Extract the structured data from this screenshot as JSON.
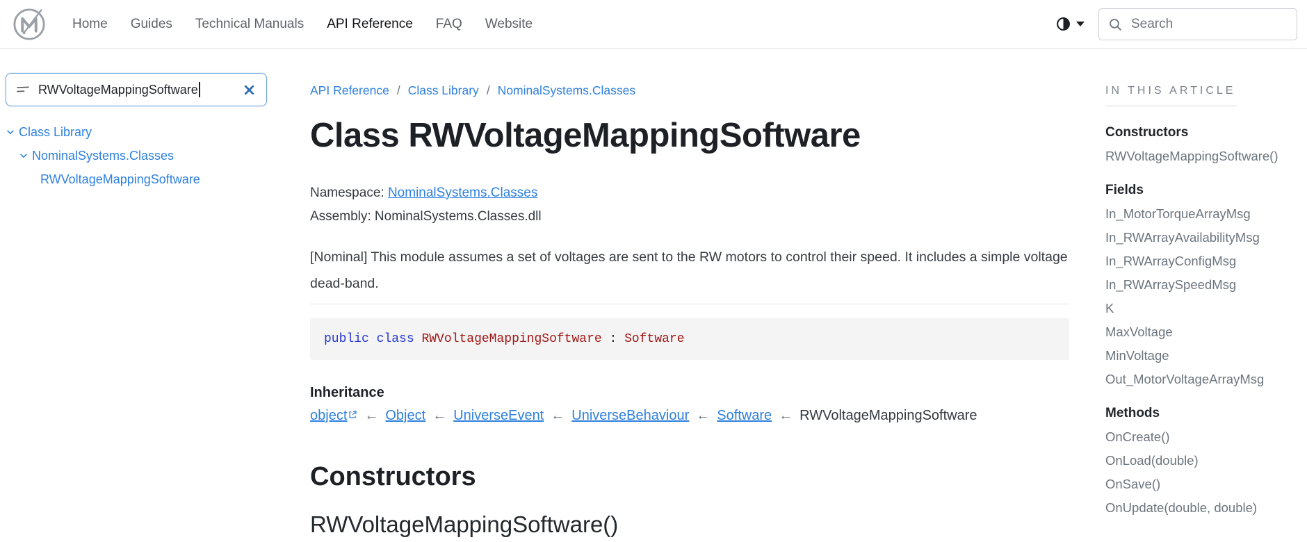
{
  "navbar": {
    "links": [
      {
        "label": "Home",
        "active": false
      },
      {
        "label": "Guides",
        "active": false
      },
      {
        "label": "Technical Manuals",
        "active": false
      },
      {
        "label": "API Reference",
        "active": true
      },
      {
        "label": "FAQ",
        "active": false
      },
      {
        "label": "Website",
        "active": false
      }
    ],
    "search": {
      "placeholder": "Search"
    },
    "theme_icon": "half-circle-icon",
    "logo_icon": "m-check-logo"
  },
  "sidebar": {
    "filter": {
      "value": "RWVoltageMappingSoftware",
      "icon": "filter-lines-icon",
      "clear_icon": "x-icon"
    },
    "tree": [
      {
        "label": "Class Library",
        "level": 0,
        "expanded": true
      },
      {
        "label": "NominalSystems.Classes",
        "level": 1,
        "expanded": true
      },
      {
        "label": "RWVoltageMappingSoftware",
        "level": 2,
        "expanded": null
      }
    ]
  },
  "breadcrumb": {
    "items": [
      "API Reference",
      "Class Library",
      "NominalSystems.Classes"
    ],
    "separator": "/"
  },
  "article": {
    "title": "Class RWVoltageMappingSoftware",
    "namespace_label": "Namespace:",
    "namespace_value": "NominalSystems.Classes",
    "assembly_label": "Assembly:",
    "assembly_value": "NominalSystems.Classes.dll",
    "description": "[Nominal] This module assumes a set of voltages are sent to the RW motors to control their speed. It includes a simple voltage dead-band.",
    "declaration_tokens": [
      {
        "text": "public",
        "type": "keyword"
      },
      {
        "text": " ",
        "type": "plain"
      },
      {
        "text": "class",
        "type": "keyword"
      },
      {
        "text": " ",
        "type": "plain"
      },
      {
        "text": "RWVoltageMappingSoftware",
        "type": "type"
      },
      {
        "text": " : ",
        "type": "plain"
      },
      {
        "text": "Software",
        "type": "type"
      }
    ],
    "inheritance": {
      "label": "Inheritance",
      "separator": "←",
      "chain": [
        {
          "label": "object",
          "link": true,
          "external": true
        },
        {
          "label": "Object",
          "link": true,
          "external": false
        },
        {
          "label": "UniverseEvent",
          "link": true,
          "external": false
        },
        {
          "label": "UniverseBehaviour",
          "link": true,
          "external": false
        },
        {
          "label": "Software",
          "link": true,
          "external": false
        },
        {
          "label": "RWVoltageMappingSoftware",
          "link": false,
          "external": false
        }
      ]
    },
    "constructors_heading": "Constructors",
    "constructor_signature": "RWVoltageMappingSoftware()"
  },
  "toc": {
    "heading": "IN THIS ARTICLE",
    "sections": [
      {
        "title": "Constructors",
        "items": [
          "RWVoltageMappingSoftware()"
        ]
      },
      {
        "title": "Fields",
        "items": [
          "In_MotorTorqueArrayMsg",
          "In_RWArrayAvailabilityMsg",
          "In_RWArrayConfigMsg",
          "In_RWArraySpeedMsg",
          "K",
          "MaxVoltage",
          "MinVoltage",
          "Out_MotorVoltageArrayMsg"
        ]
      },
      {
        "title": "Methods",
        "items": [
          "OnCreate()",
          "OnLoad(double)",
          "OnSave()",
          "OnUpdate(double, double)"
        ]
      }
    ]
  },
  "colors": {
    "link_blue": "#2e80df",
    "code_keyword": "#2636d4",
    "code_type": "#a31515",
    "code_background": "#f4f4f4",
    "text_dark": "#1d2126",
    "text_muted": "#6c757d"
  }
}
